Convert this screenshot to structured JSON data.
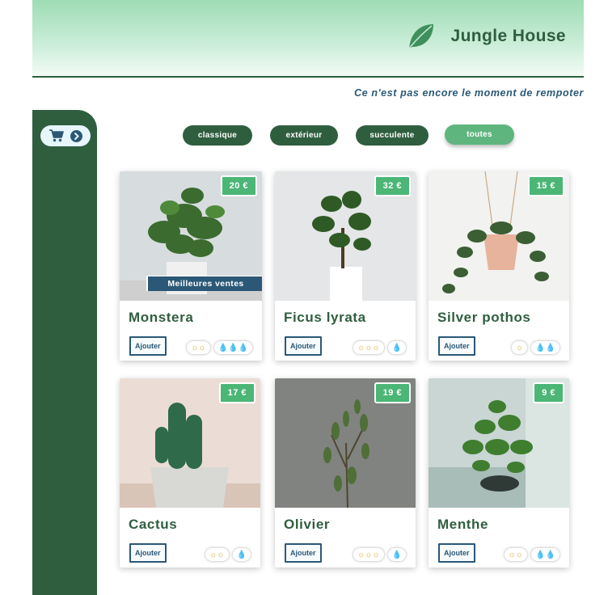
{
  "brand": {
    "title": "Jungle House"
  },
  "tagline": "Ce n'est pas encore le moment de rempoter",
  "sidebar": {
    "cart_icon": "cart-icon",
    "toggle_icon": "chevron-right-circle-icon"
  },
  "filters": [
    {
      "label": "classique",
      "active": false
    },
    {
      "label": "extérieur",
      "active": false
    },
    {
      "label": "succulente",
      "active": false
    },
    {
      "label": "toutes",
      "active": true
    }
  ],
  "products": [
    {
      "name": "Monstera",
      "price": "20 €",
      "badge": "Meilleures ventes",
      "add_label": "Ajouter",
      "light": 2,
      "water": 3,
      "light_text": "☼☼",
      "water_text": "💧💧💧"
    },
    {
      "name": "Ficus lyrata",
      "price": "32 €",
      "badge": "",
      "add_label": "Ajouter",
      "light": 3,
      "water": 1,
      "light_text": "☼☼☼",
      "water_text": "💧"
    },
    {
      "name": "Silver pothos",
      "price": "15 €",
      "badge": "",
      "add_label": "Ajouter",
      "light": 1,
      "water": 2,
      "light_text": "☼",
      "water_text": "💧💧"
    },
    {
      "name": "Cactus",
      "price": "17 €",
      "badge": "",
      "add_label": "Ajouter",
      "light": 2,
      "water": 1,
      "light_text": "☼☼",
      "water_text": "💧"
    },
    {
      "name": "Olivier",
      "price": "19 €",
      "badge": "",
      "add_label": "Ajouter",
      "light": 3,
      "water": 1,
      "light_text": "☼☼☼",
      "water_text": "💧"
    },
    {
      "name": "Menthe",
      "price": "9 €",
      "badge": "",
      "add_label": "Ajouter",
      "light": 2,
      "water": 2,
      "light_text": "☼☼",
      "water_text": "💧💧"
    }
  ],
  "colors": {
    "primary": "#2f5e3f",
    "accent": "#4bb676",
    "secondary": "#2b5876",
    "sun": "#d4a72c"
  }
}
